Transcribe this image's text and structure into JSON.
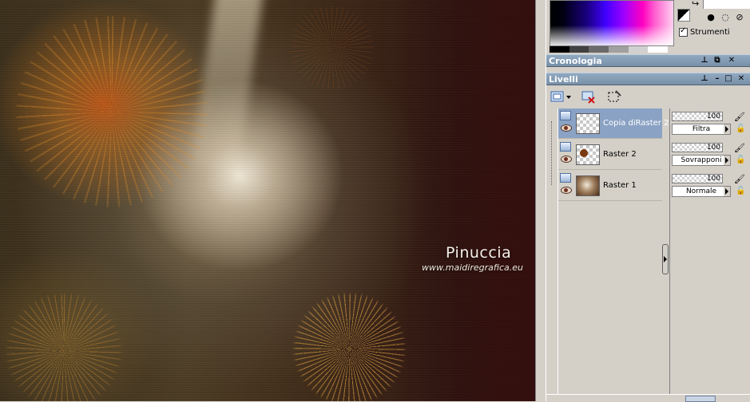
{
  "watermark": {
    "title": "Pinuccia",
    "url": "www.maidiregrafica.eu"
  },
  "materials": {
    "strumenti_label": "Strumenti",
    "strumenti_checked": true,
    "gray_strip": [
      "#000000",
      "#404040",
      "#6a6a6a",
      "#a0a0a0",
      "#d0d0d0",
      "#ffffff"
    ]
  },
  "panels": {
    "history_title": "Cronologia",
    "layers_title": "Livelli",
    "title_buttons": [
      "⊥",
      "⧉",
      "✕"
    ]
  },
  "layers": [
    {
      "name": "Copia diRaster 2",
      "opacity": "100",
      "blend": "Filtra",
      "selected": true,
      "thumb": "checker"
    },
    {
      "name": "Raster 2",
      "opacity": "100",
      "blend": "Sovrapponi",
      "selected": false,
      "thumb": "checker-dot"
    },
    {
      "name": "Raster 1",
      "opacity": "100",
      "blend": "Normale",
      "selected": false,
      "thumb": "image"
    }
  ],
  "icons": {
    "new_layer": "new-layer-icon",
    "delete_layer": "delete-layer-icon",
    "mask": "selection-icon",
    "pin": "pin-icon",
    "restore": "restore-icon",
    "close": "close-icon",
    "brush": "brush-icon",
    "lock": "lock-icon",
    "eye": "eye-icon"
  }
}
